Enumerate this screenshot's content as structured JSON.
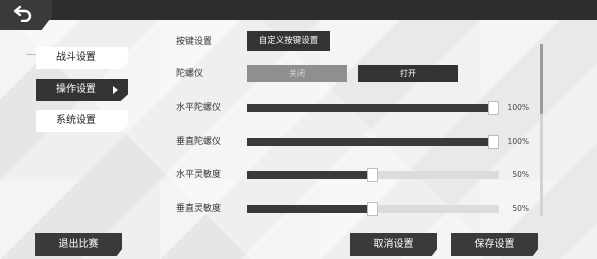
{
  "sidebar": {
    "items": [
      {
        "label": "战斗设置",
        "active": false
      },
      {
        "label": "操作设置",
        "active": true
      },
      {
        "label": "系统设置",
        "active": false
      }
    ]
  },
  "settings": {
    "key_settings": {
      "label": "按键设置",
      "button_label": "自定义按键设置"
    },
    "gyroscope": {
      "label": "陀螺仪",
      "off_label": "关闭",
      "on_label": "打开",
      "selected": "on"
    },
    "sliders": [
      {
        "label": "水平陀螺仪",
        "value": 100,
        "value_text": "100%"
      },
      {
        "label": "垂直陀螺仪",
        "value": 100,
        "value_text": "100%"
      },
      {
        "label": "水平灵敏度",
        "value": 50,
        "value_text": "50%"
      },
      {
        "label": "垂直灵敏度",
        "value": 50,
        "value_text": "50%"
      }
    ]
  },
  "footer": {
    "exit_label": "退出比赛",
    "cancel_label": "取消设置",
    "save_label": "保存设置"
  },
  "icons": {
    "back": "back-arrow-icon"
  }
}
